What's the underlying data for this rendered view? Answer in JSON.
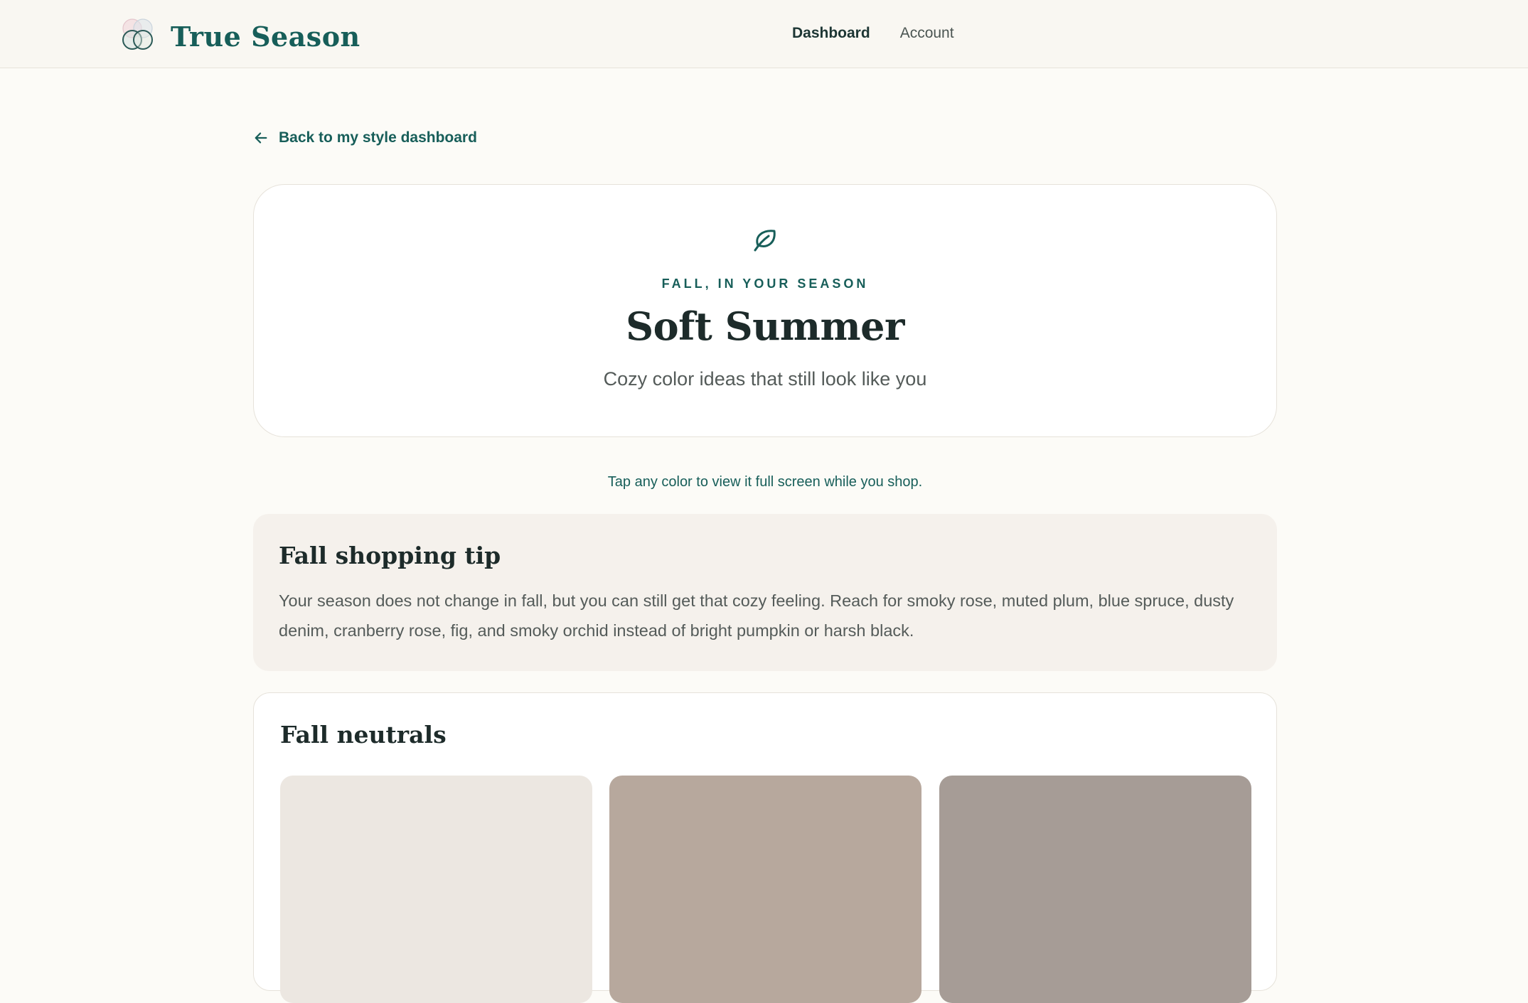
{
  "header": {
    "brand": "True Season",
    "nav": [
      {
        "label": "Dashboard",
        "active": true
      },
      {
        "label": "Account",
        "active": false
      }
    ]
  },
  "back_link": {
    "label": "Back to my style dashboard"
  },
  "hero": {
    "icon": "leaf-icon",
    "eyebrow": "FALL, IN YOUR SEASON",
    "title": "Soft Summer",
    "subtitle": "Cozy color ideas that still look like you"
  },
  "hint": "Tap any color to view it full screen while you shop.",
  "tip": {
    "title": "Fall shopping tip",
    "body": "Your season does not change in fall, but you can still get that cozy feeling. Reach for smoky rose, muted plum, blue spruce, dusty denim, cranberry rose, fig, and smoky orchid instead of bright pumpkin or harsh black."
  },
  "neutrals": {
    "title": "Fall neutrals",
    "swatches": [
      {
        "color": "#ece7e1"
      },
      {
        "color": "#b7a89d"
      },
      {
        "color": "#a69c96"
      }
    ]
  },
  "colors": {
    "accent": "#175e59",
    "background": "#fcfbf7",
    "header_background": "#f9f7f2",
    "tip_background": "#f5f1ec"
  }
}
